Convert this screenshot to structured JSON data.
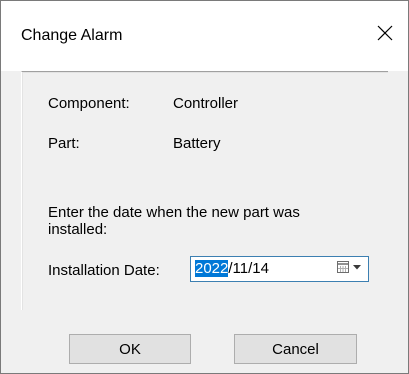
{
  "dialog": {
    "title": "Change Alarm",
    "close_glyph": "✕"
  },
  "info": {
    "component_label": "Component:",
    "component_value": "Controller",
    "part_label": "Part:",
    "part_value": "Battery"
  },
  "prompt": {
    "line1": "Enter the date when the new part was",
    "line2": "installed:"
  },
  "date_field": {
    "label": "Installation Date:",
    "selected_text": "2022",
    "rest_text": "/11/14",
    "icon": "calendar-dropdown-icon"
  },
  "buttons": {
    "ok_label": "OK",
    "cancel_label": "Cancel"
  },
  "colors": {
    "selection": "#0078d7",
    "focus_border": "#3c7fb1",
    "button_face": "#e1e1e1"
  }
}
